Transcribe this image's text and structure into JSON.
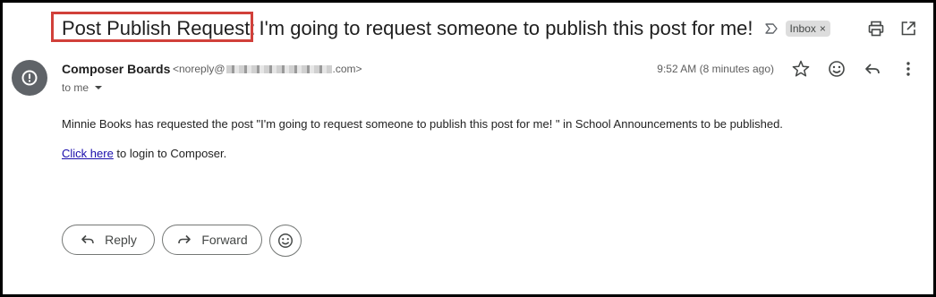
{
  "subject": {
    "prefix": "Post Publish Request:",
    "rest": "I'm going to request someone to publish this post for me!",
    "label_badge": "Inbox",
    "badge_close": "×"
  },
  "colors": {
    "highlight_box": "#d1403a",
    "link": "#1a0dab",
    "avatar_bg": "#5f6368"
  },
  "icons": {
    "label_arrow": "label-arrow-icon",
    "print": "print-icon",
    "open_new_window": "open-in-new-window-icon",
    "avatar": "alert-circle-icon",
    "star": "star-icon",
    "emoji": "emoji-reaction-icon",
    "reply": "reply-icon",
    "more": "more-vertical-icon",
    "forward": "forward-icon"
  },
  "message": {
    "sender_name": "Composer Boards",
    "sender_email_prefix": "<noreply@",
    "sender_email_suffix": ".com>",
    "recipient_label": "to me",
    "timestamp": "9:52 AM (8 minutes ago)",
    "body": "Minnie Books has requested the post \"I'm going to request someone to publish this post for me! \" in School Announcements to be published.",
    "link_text": "Click here",
    "link_suffix": " to login to Composer."
  },
  "actions": {
    "reply_label": "Reply",
    "forward_label": "Forward"
  }
}
